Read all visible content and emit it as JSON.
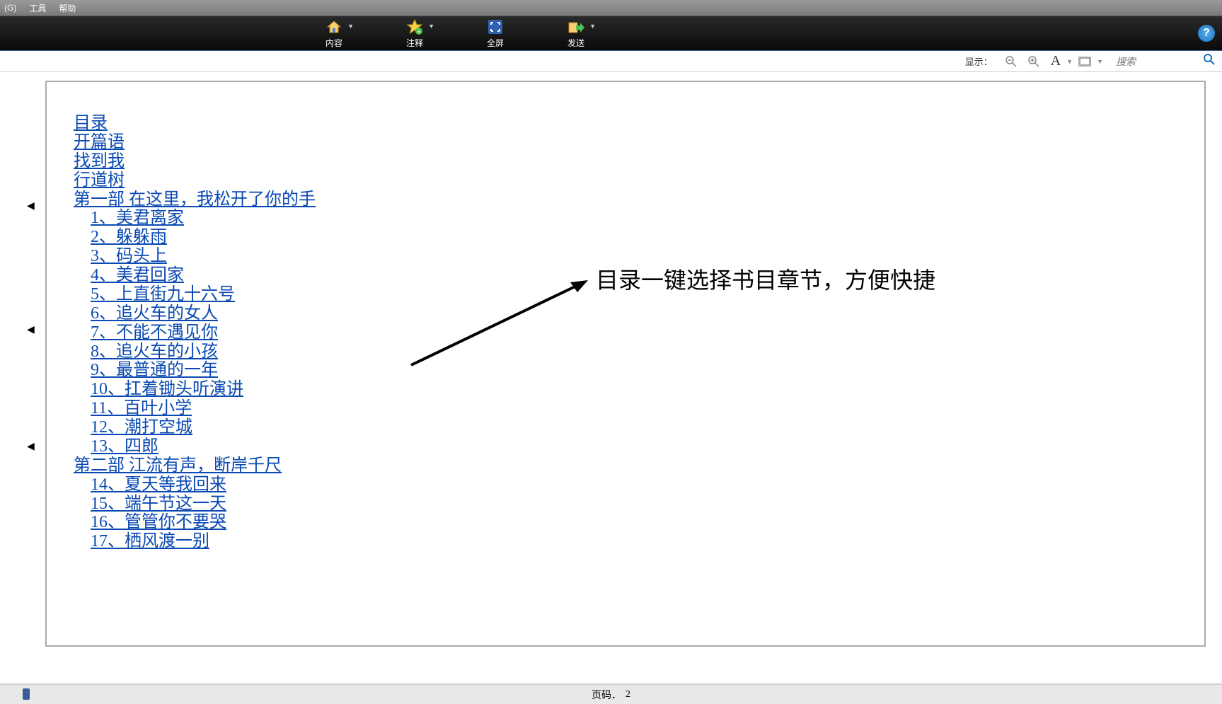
{
  "menubar": {
    "items": [
      "(G)",
      "工具",
      "帮助"
    ]
  },
  "toolbar": {
    "content": "内容",
    "annotate": "注释",
    "fullscreen": "全屏",
    "send": "发送"
  },
  "controls": {
    "display_label": "显示：",
    "font_symbol": "A",
    "search_placeholder": "搜索"
  },
  "toc": {
    "top": [
      "目录",
      "开篇语",
      "找到我",
      "行道树"
    ],
    "part1": "第一部  在这里，我松开了你的手",
    "part1_items": [
      "1、美君离家",
      "2、躲躲雨",
      "3、码头上",
      "4、美君回家",
      "5、上直街九十六号",
      "6、追火车的女人",
      "7、不能不遇见你",
      "8、追火车的小孩",
      "9、最普通的一年",
      "10、扛着锄头听演讲",
      "11、百叶小学",
      "12、潮打空城",
      "13、四郎"
    ],
    "part2": "第二部  江流有声，断岸千尺",
    "part2_items": [
      "14、夏天等我回来",
      "15、端午节这一天",
      "16、管管你不要哭",
      "17、栖风渡一别"
    ]
  },
  "annotation_text": "目录一键选择书目章节，方便快捷",
  "status": {
    "page_label": "页码．",
    "page_number": "2"
  }
}
